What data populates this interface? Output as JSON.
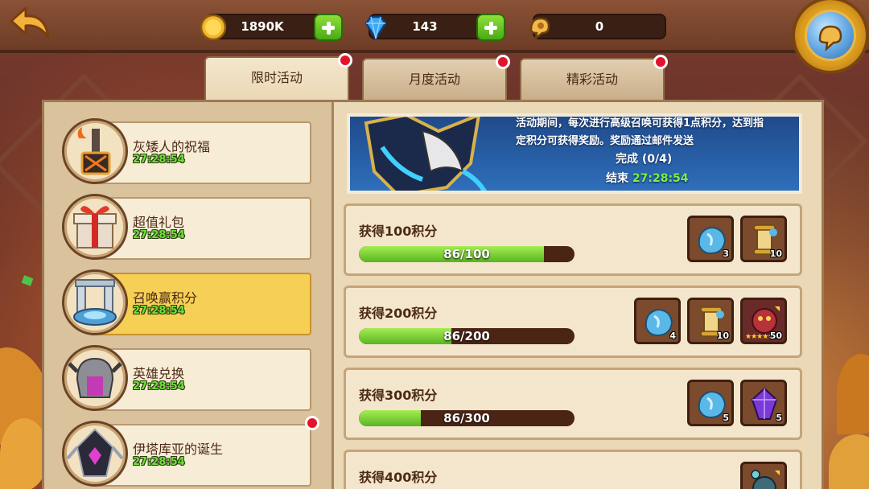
{
  "resources": {
    "gold": {
      "value": "1890K",
      "icon": "gold-coin-icon"
    },
    "diamond": {
      "value": "143",
      "icon": "diamond-icon"
    },
    "scroll": {
      "value": "0",
      "icon": "summon-scroll-icon"
    }
  },
  "tabs": [
    {
      "label": "限时活动",
      "active": true,
      "alert": true
    },
    {
      "label": "月度活动",
      "active": false,
      "alert": true
    },
    {
      "label": "精彩活动",
      "active": false,
      "alert": true
    }
  ],
  "events": [
    {
      "title": "灰矮人的祝福",
      "timer": "27:28:54",
      "icon": "dwarf-hammer-icon",
      "active": false,
      "alert": false
    },
    {
      "title": "超值礼包",
      "timer": "27:28:54",
      "icon": "gift-box-icon",
      "active": false,
      "alert": false
    },
    {
      "title": "召唤赢积分",
      "timer": "27:28:54",
      "icon": "summon-altar-icon",
      "active": true,
      "alert": false
    },
    {
      "title": "英雄兑换",
      "timer": "27:28:54",
      "icon": "hero-helmet-icon",
      "active": false,
      "alert": false
    },
    {
      "title": "伊塔库亚的诞生",
      "timer": "27:28:54",
      "icon": "dark-helmet-icon",
      "active": false,
      "alert": true
    }
  ],
  "banner": {
    "desc_line1": "活动期间，每次进行高级召唤可获得1点积分，达到指",
    "desc_line2": "定积分可获得奖励。奖励通过邮件发送",
    "progress": "完成 (0/4)",
    "end_label": "结束",
    "end_time": "27:28:54"
  },
  "rewards": [
    {
      "label": "获得100积分",
      "progress_text": "86/100",
      "progress": 0.86,
      "items": [
        {
          "icon": "blue-soul-stone-icon",
          "count": "3"
        },
        {
          "icon": "golden-scroll-icon",
          "count": "10"
        }
      ]
    },
    {
      "label": "获得200积分",
      "progress_text": "86/200",
      "progress": 0.43,
      "items": [
        {
          "icon": "blue-soul-stone-icon",
          "count": "4"
        },
        {
          "icon": "golden-scroll-icon",
          "count": "10"
        },
        {
          "icon": "hero-shard-icon",
          "count": "50",
          "stars": "★★★★★"
        }
      ]
    },
    {
      "label": "获得300积分",
      "progress_text": "86/300",
      "progress": 0.287,
      "items": [
        {
          "icon": "blue-soul-stone-icon",
          "count": "5"
        },
        {
          "icon": "purple-crystal-icon",
          "count": "5"
        }
      ]
    },
    {
      "label": "获得400积分",
      "progress_text": "",
      "progress": 0,
      "items": [
        {
          "icon": "hero-card-icon",
          "count": ""
        }
      ]
    }
  ],
  "colors": {
    "accent_green": "#6fe13a",
    "alert_red": "#e2142b",
    "active_yellow": "#f6cf55"
  }
}
